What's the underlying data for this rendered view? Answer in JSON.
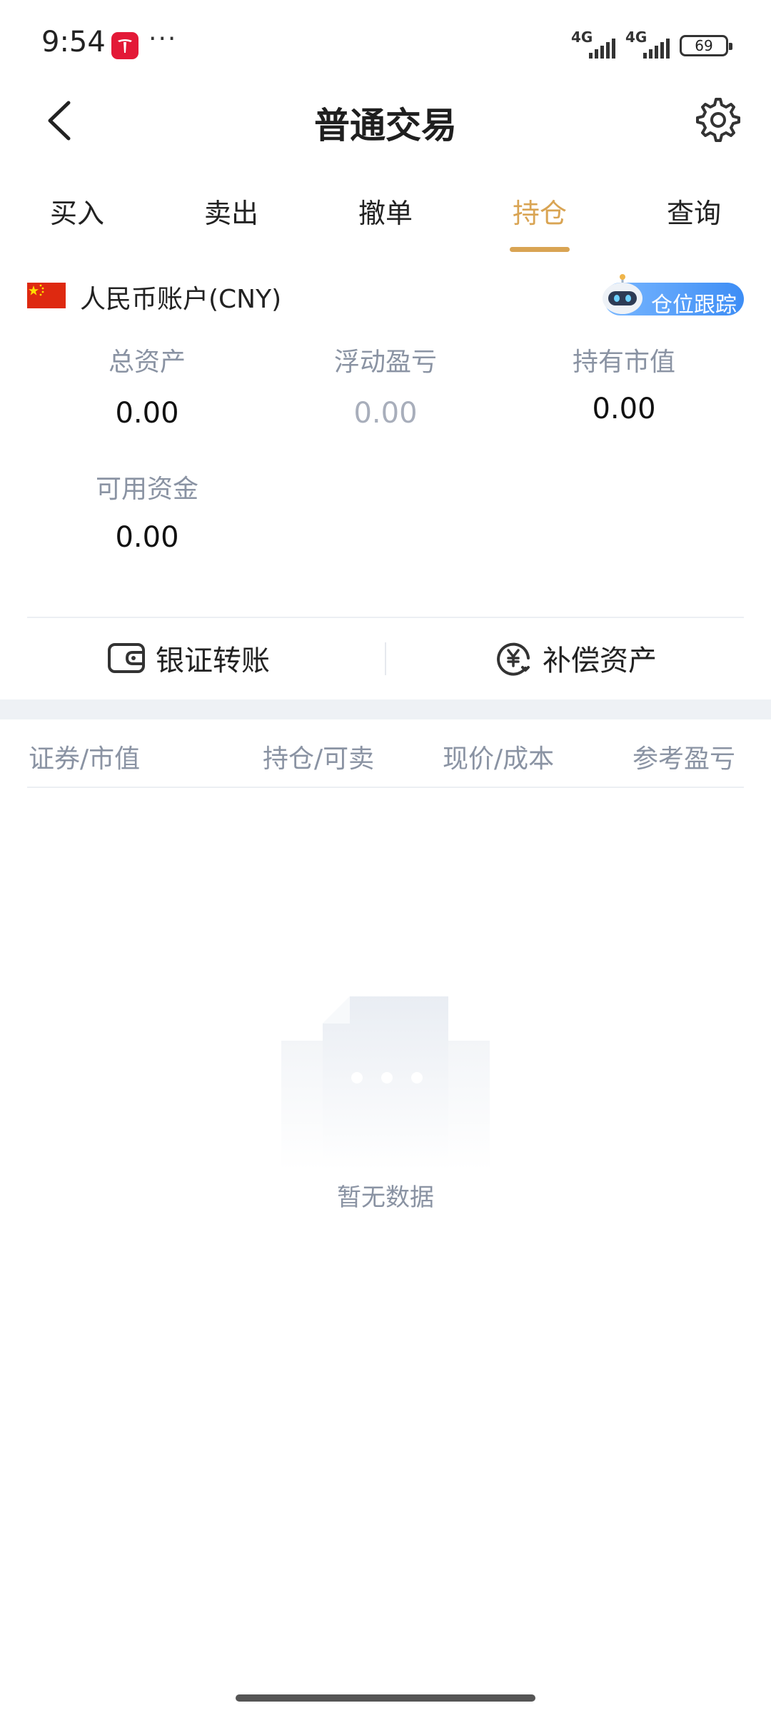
{
  "status_bar": {
    "time": "9:54",
    "more": "···",
    "network_1": "4G",
    "network_2": "4G",
    "battery": "69"
  },
  "header": {
    "title": "普通交易",
    "back_icon": "chevron-left-icon",
    "settings_icon": "gear-icon"
  },
  "tabs": [
    {
      "label": "买入"
    },
    {
      "label": "卖出"
    },
    {
      "label": "撤单"
    },
    {
      "label": "持仓",
      "active": true
    },
    {
      "label": "查询"
    }
  ],
  "account": {
    "label": "人民币账户(CNY)",
    "track_button": "仓位跟踪"
  },
  "stats": {
    "total_assets": {
      "label": "总资产",
      "value": "0.00"
    },
    "floating_pl": {
      "label": "浮动盈亏",
      "value": "0.00"
    },
    "market_value": {
      "label": "持有市值",
      "value": "0.00"
    },
    "available_funds": {
      "label": "可用资金",
      "value": "0.00"
    }
  },
  "actions": {
    "bank_transfer": "银证转账",
    "compensation": "补偿资产"
  },
  "table": {
    "columns": [
      "证券/市值",
      "持仓/可卖",
      "现价/成本",
      "参考盈亏"
    ]
  },
  "empty": {
    "text": "暂无数据"
  },
  "colors": {
    "accent": "#d9a453",
    "muted": "#8a93a3",
    "track_button": "#3d8df5"
  }
}
